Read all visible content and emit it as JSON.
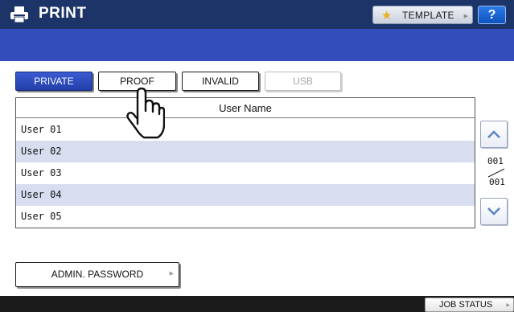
{
  "header": {
    "title": "PRINT",
    "icon": "printer-icon",
    "template_label": "TEMPLATE",
    "template_icon": "star-icon",
    "help_label": "?"
  },
  "colors": {
    "title_bar": "#1d3468",
    "message_band": "#334dbb",
    "active_tab": "#2a48bd",
    "row_shade": "#d8ddf0",
    "bottom_bar": "#1b1b1b"
  },
  "tabs": [
    {
      "label": "PRIVATE",
      "state": "selected"
    },
    {
      "label": "PROOF",
      "state": "normal"
    },
    {
      "label": "INVALID",
      "state": "normal"
    },
    {
      "label": "USB",
      "state": "disabled"
    }
  ],
  "table": {
    "header": "User Name",
    "rows": [
      "User 01",
      "User 02",
      "User 03",
      "User 04",
      "User 05"
    ]
  },
  "pagination": {
    "current": "001",
    "total": "001",
    "up_icon": "chevron-up-icon",
    "down_icon": "chevron-down-icon"
  },
  "admin_password_label": "ADMIN. PASSWORD",
  "footer": {
    "job_status_label": "JOB STATUS"
  },
  "cursor_icon": "hand-pointer-icon"
}
